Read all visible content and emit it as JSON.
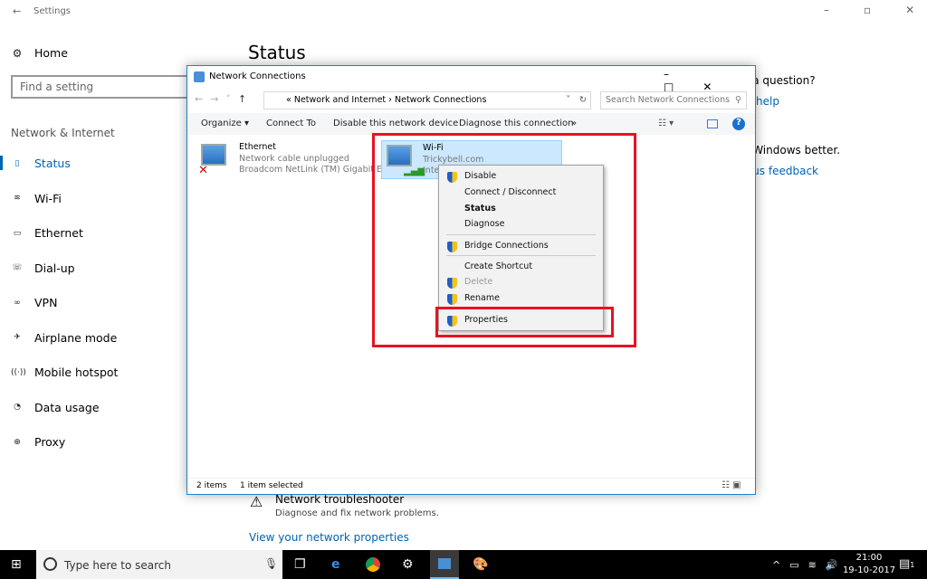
{
  "settings": {
    "title": "Settings",
    "home": "Home",
    "search_placeholder": "Find a setting",
    "section": "Network & Internet",
    "nav": [
      {
        "label": "Status",
        "icon": "home-status-icon"
      },
      {
        "label": "Wi-Fi",
        "icon": "wifi-icon"
      },
      {
        "label": "Ethernet",
        "icon": "ethernet-icon"
      },
      {
        "label": "Dial-up",
        "icon": "dialup-icon"
      },
      {
        "label": "VPN",
        "icon": "vpn-icon"
      },
      {
        "label": "Airplane mode",
        "icon": "airplane-icon"
      },
      {
        "label": "Mobile hotspot",
        "icon": "hotspot-icon"
      },
      {
        "label": "Data usage",
        "icon": "data-usage-icon"
      },
      {
        "label": "Proxy",
        "icon": "proxy-icon"
      }
    ],
    "page_title": "Status",
    "right_q": "e a question?",
    "right_help": "help",
    "right_better": "e Windows better.",
    "right_feedback": "e us feedback",
    "troubleshooter_title": "Network troubleshooter",
    "troubleshooter_desc": "Diagnose and fix network problems.",
    "view_props": "View your network properties"
  },
  "dialog": {
    "title": "Network Connections",
    "crumb1": "Network and Internet",
    "crumb2": "Network Connections",
    "search_placeholder": "Search Network Connections",
    "toolbar": [
      "Organize ▾",
      "Connect To",
      "Disable this network device",
      "Diagnose this connection",
      "»"
    ],
    "items": [
      {
        "name": "Ethernet",
        "status": "Network cable unplugged",
        "device": "Broadcom NetLink (TM) Gigabit E..."
      },
      {
        "name": "Wi-Fi",
        "status": "Trickybell.com",
        "device": "Intel"
      }
    ],
    "status_count": "2 items",
    "status_selected": "1 item selected"
  },
  "menu": [
    {
      "label": "Disable",
      "shield": true
    },
    {
      "label": "Connect / Disconnect"
    },
    {
      "label": "Status",
      "bold": true
    },
    {
      "label": "Diagnose"
    },
    {
      "label": "Bridge Connections",
      "shield": true
    },
    {
      "label": "Create Shortcut"
    },
    {
      "label": "Delete",
      "shield": true,
      "disabled": true
    },
    {
      "label": "Rename",
      "shield": true
    },
    {
      "label": "Properties",
      "shield": true
    }
  ],
  "taskbar": {
    "search": "Type here to search",
    "time": "21:00",
    "date": "19-10-2017",
    "notifications": "1"
  },
  "colors": {
    "accent": "#0063b1",
    "highlight": "#e81123"
  }
}
